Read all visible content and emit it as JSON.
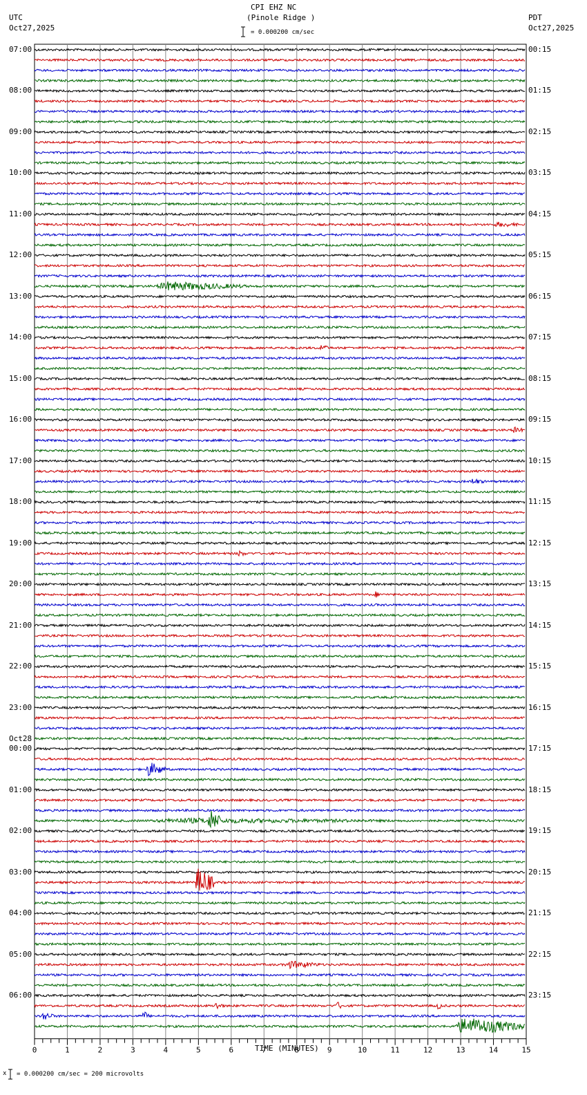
{
  "header": {
    "station": "CPI EHZ NC",
    "location": "(Pinole Ridge )",
    "left_tz": "UTC",
    "left_date": "Oct27,2025",
    "right_tz": "PDT",
    "right_date": "Oct27,2025",
    "scale": "= 0.000200 cm/sec"
  },
  "footer": {
    "scale": "= 0.000200 cm/sec =     200 microvolts",
    "prefix": "x"
  },
  "chart_data": {
    "type": "line",
    "title": "CPI EHZ NC (Pinole Ridge )",
    "xlabel": "TIME (MINUTES)",
    "xlim": [
      0,
      15
    ],
    "x_ticks": [
      "0",
      "1",
      "2",
      "3",
      "4",
      "5",
      "6",
      "7",
      "8",
      "9",
      "10",
      "11",
      "12",
      "13",
      "14",
      "15"
    ],
    "traces_per_hour": 4,
    "trace_count": 96,
    "colors": [
      "#000000",
      "#cc0000",
      "#0000cc",
      "#006600"
    ],
    "left_labels": [
      "07:00",
      "08:00",
      "09:00",
      "10:00",
      "11:00",
      "12:00",
      "13:00",
      "14:00",
      "15:00",
      "16:00",
      "17:00",
      "18:00",
      "19:00",
      "20:00",
      "21:00",
      "22:00",
      "23:00",
      "00:00",
      "01:00",
      "02:00",
      "03:00",
      "04:00",
      "05:00",
      "06:00"
    ],
    "date_change_label": "Oct28",
    "right_labels": [
      "00:15",
      "01:15",
      "02:15",
      "03:15",
      "04:15",
      "05:15",
      "06:15",
      "07:15",
      "08:15",
      "09:15",
      "10:15",
      "11:15",
      "12:15",
      "13:15",
      "14:15",
      "15:15",
      "16:15",
      "17:15",
      "18:15",
      "19:15",
      "20:15",
      "21:15",
      "22:15",
      "23:15"
    ],
    "events": [
      {
        "trace": 17,
        "start": 14.0,
        "end": 15.0,
        "amp": 4
      },
      {
        "trace": 23,
        "start": 3.6,
        "end": 6.5,
        "amp": 7
      },
      {
        "trace": 29,
        "start": 8.7,
        "end": 9.0,
        "amp": 6
      },
      {
        "trace": 37,
        "start": 14.6,
        "end": 15.0,
        "amp": 5
      },
      {
        "trace": 42,
        "start": 13.3,
        "end": 13.8,
        "amp": 5
      },
      {
        "trace": 49,
        "start": 6.2,
        "end": 6.5,
        "amp": 5
      },
      {
        "trace": 53,
        "start": 10.4,
        "end": 10.6,
        "amp": 5
      },
      {
        "trace": 70,
        "start": 3.4,
        "end": 4.0,
        "amp": 11
      },
      {
        "trace": 75,
        "start": 3.0,
        "end": 12.5,
        "amp": 4
      },
      {
        "trace": 75,
        "start": 5.3,
        "end": 5.7,
        "amp": 18
      },
      {
        "trace": 81,
        "start": 4.9,
        "end": 5.5,
        "amp": 22
      },
      {
        "trace": 89,
        "start": 7.6,
        "end": 8.8,
        "amp": 6
      },
      {
        "trace": 93,
        "start": 5.5,
        "end": 5.8,
        "amp": 6
      },
      {
        "trace": 93,
        "start": 9.2,
        "end": 9.5,
        "amp": 6
      },
      {
        "trace": 93,
        "start": 12.3,
        "end": 12.5,
        "amp": 6
      },
      {
        "trace": 94,
        "start": 0.2,
        "end": 0.6,
        "amp": 7
      },
      {
        "trace": 94,
        "start": 3.3,
        "end": 3.5,
        "amp": 8
      },
      {
        "trace": 95,
        "start": 12.8,
        "end": 15.0,
        "amp": 13
      }
    ]
  }
}
